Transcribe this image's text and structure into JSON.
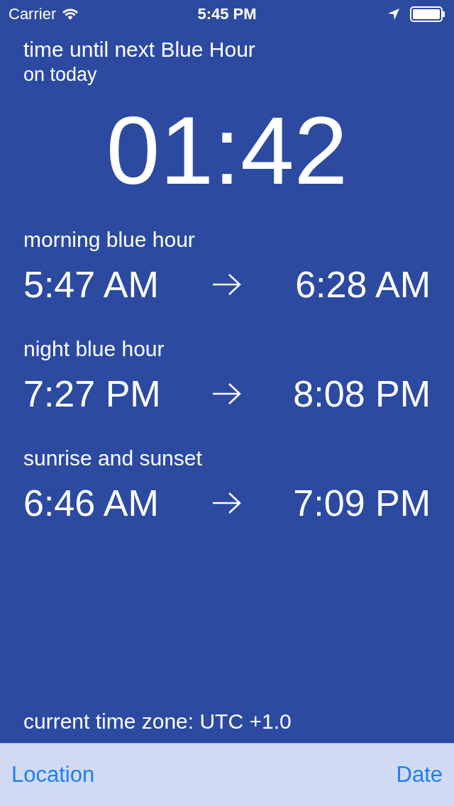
{
  "status_bar": {
    "carrier": "Carrier",
    "time": "5:45 PM"
  },
  "header": {
    "title": "time until next Blue Hour",
    "subtitle": "on today"
  },
  "countdown": "01:42",
  "sections": [
    {
      "label": "morning blue hour",
      "start": "5:47 AM",
      "end": "6:28 AM"
    },
    {
      "label": "night blue hour",
      "start": "7:27 PM",
      "end": "8:08 PM"
    },
    {
      "label": "sunrise and sunset",
      "start": "6:46 AM",
      "end": "7:09 PM"
    }
  ],
  "time_zone": "current time zone: UTC +1.0",
  "toolbar": {
    "left": "Location",
    "right": "Date"
  }
}
